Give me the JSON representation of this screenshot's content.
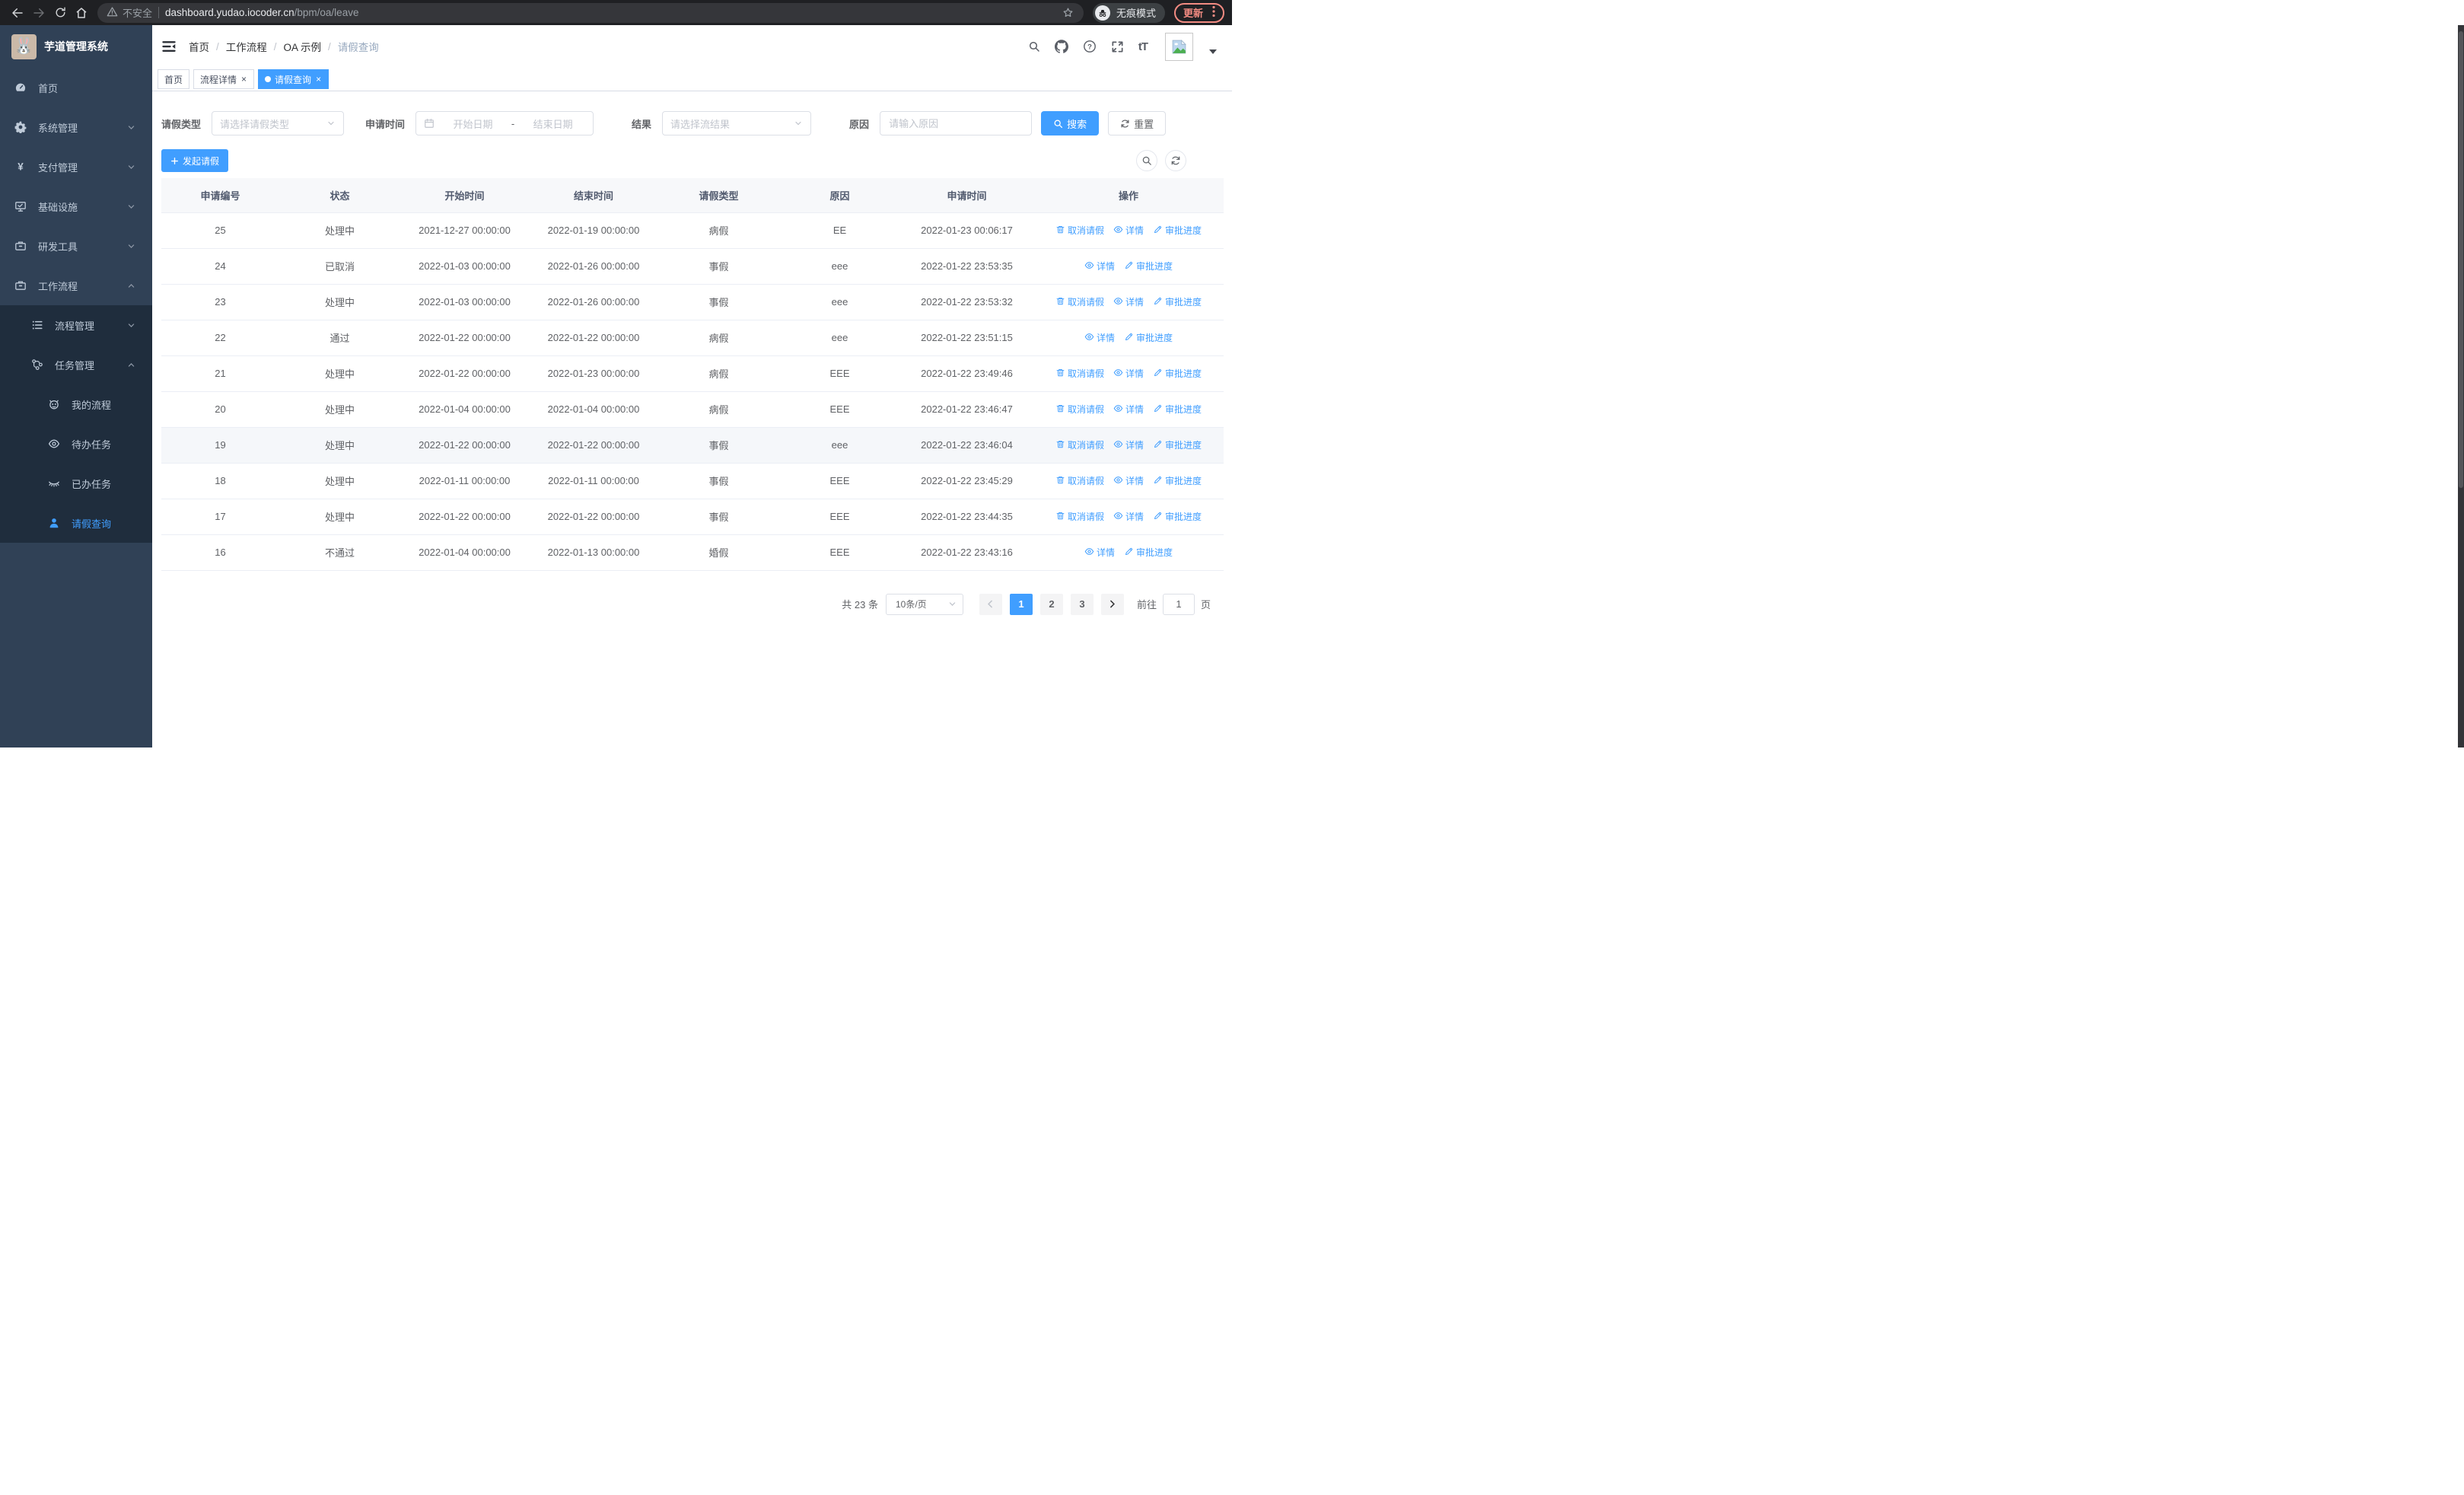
{
  "colors": {
    "primary": "#409EFF",
    "sidebar_bg": "#304156",
    "submenu_bg": "#1f2d3d"
  },
  "browser": {
    "security_label": "不安全",
    "url_host": "dashboard.yudao.iocoder.cn",
    "url_path": "/bpm/oa/leave",
    "incognito_label": "无痕模式",
    "update_label": "更新"
  },
  "sidebar": {
    "title": "芋道管理系统",
    "menu": [
      {
        "name": "home",
        "label": "首页",
        "icon": "gauge-icon",
        "level": 1
      },
      {
        "name": "system",
        "label": "系统管理",
        "icon": "gear-icon",
        "level": 1,
        "chevron": "down"
      },
      {
        "name": "payment",
        "label": "支付管理",
        "icon": "yen-icon",
        "level": 1,
        "chevron": "down"
      },
      {
        "name": "infra",
        "label": "基础设施",
        "icon": "monitor-icon",
        "level": 1,
        "chevron": "down"
      },
      {
        "name": "devtools",
        "label": "研发工具",
        "icon": "toolbox-icon",
        "level": 1,
        "chevron": "down"
      },
      {
        "name": "workflow",
        "label": "工作流程",
        "icon": "briefcase-icon",
        "level": 1,
        "chevron": "up"
      },
      {
        "name": "process-mgmt",
        "label": "流程管理",
        "icon": "list-icon",
        "level": 2,
        "sub": true,
        "chevron": "down"
      },
      {
        "name": "task-mgmt",
        "label": "任务管理",
        "icon": "branch-icon",
        "level": 2,
        "sub": true,
        "chevron": "up"
      },
      {
        "name": "my-process",
        "label": "我的流程",
        "icon": "robot-icon",
        "level": 3,
        "sub": true
      },
      {
        "name": "todo-task",
        "label": "待办任务",
        "icon": "eye-icon",
        "level": 3,
        "sub": true
      },
      {
        "name": "done-task",
        "label": "已办任务",
        "icon": "eye-closed-icon",
        "level": 3,
        "sub": true
      },
      {
        "name": "leave-query",
        "label": "请假查询",
        "icon": "user-icon",
        "level": 3,
        "sub": true,
        "active": true
      }
    ]
  },
  "header": {
    "breadcrumb": [
      "首页",
      "工作流程",
      "OA 示例",
      "请假查询"
    ],
    "icons": [
      "search-icon",
      "github-icon",
      "help-icon",
      "fullscreen-icon",
      "fontsize-icon"
    ],
    "fontsize_glyph": "tT"
  },
  "tabs": [
    {
      "label": "首页"
    },
    {
      "label": "流程详情",
      "closable": true
    },
    {
      "label": "请假查询",
      "closable": true,
      "active": true
    }
  ],
  "filters": {
    "leave_type_label": "请假类型",
    "leave_type_placeholder": "请选择请假类型",
    "apply_time_label": "申请时间",
    "date_start_placeholder": "开始日期",
    "date_separator": "-",
    "date_end_placeholder": "结束日期",
    "result_label": "结果",
    "result_placeholder": "请选择流结果",
    "reason_label": "原因",
    "reason_placeholder": "请输入原因",
    "search_button": "搜索",
    "reset_button": "重置"
  },
  "toolbar": {
    "create_button": "发起请假"
  },
  "table": {
    "columns": [
      "申请编号",
      "状态",
      "开始时间",
      "结束时间",
      "请假类型",
      "原因",
      "申请时间",
      "操作"
    ],
    "action_labels": {
      "cancel": "取消请假",
      "detail": "详情",
      "progress": "审批进度"
    },
    "rows": [
      {
        "id": "25",
        "status": "处理中",
        "start": "2021-12-27 00:00:00",
        "end": "2022-01-19 00:00:00",
        "type": "病假",
        "reason": "EE",
        "apply_time": "2022-01-23 00:06:17",
        "actions": [
          "cancel",
          "detail",
          "progress"
        ]
      },
      {
        "id": "24",
        "status": "已取消",
        "start": "2022-01-03 00:00:00",
        "end": "2022-01-26 00:00:00",
        "type": "事假",
        "reason": "eee",
        "apply_time": "2022-01-22 23:53:35",
        "actions": [
          "detail",
          "progress"
        ]
      },
      {
        "id": "23",
        "status": "处理中",
        "start": "2022-01-03 00:00:00",
        "end": "2022-01-26 00:00:00",
        "type": "事假",
        "reason": "eee",
        "apply_time": "2022-01-22 23:53:32",
        "actions": [
          "cancel",
          "detail",
          "progress"
        ]
      },
      {
        "id": "22",
        "status": "通过",
        "start": "2022-01-22 00:00:00",
        "end": "2022-01-22 00:00:00",
        "type": "病假",
        "reason": "eee",
        "apply_time": "2022-01-22 23:51:15",
        "actions": [
          "detail",
          "progress"
        ]
      },
      {
        "id": "21",
        "status": "处理中",
        "start": "2022-01-22 00:00:00",
        "end": "2022-01-23 00:00:00",
        "type": "病假",
        "reason": "EEE",
        "apply_time": "2022-01-22 23:49:46",
        "actions": [
          "cancel",
          "detail",
          "progress"
        ]
      },
      {
        "id": "20",
        "status": "处理中",
        "start": "2022-01-04 00:00:00",
        "end": "2022-01-04 00:00:00",
        "type": "病假",
        "reason": "EEE",
        "apply_time": "2022-01-22 23:46:47",
        "actions": [
          "cancel",
          "detail",
          "progress"
        ]
      },
      {
        "id": "19",
        "status": "处理中",
        "start": "2022-01-22 00:00:00",
        "end": "2022-01-22 00:00:00",
        "type": "事假",
        "reason": "eee",
        "apply_time": "2022-01-22 23:46:04",
        "actions": [
          "cancel",
          "detail",
          "progress"
        ],
        "hover": true
      },
      {
        "id": "18",
        "status": "处理中",
        "start": "2022-01-11 00:00:00",
        "end": "2022-01-11 00:00:00",
        "type": "事假",
        "reason": "EEE",
        "apply_time": "2022-01-22 23:45:29",
        "actions": [
          "cancel",
          "detail",
          "progress"
        ]
      },
      {
        "id": "17",
        "status": "处理中",
        "start": "2022-01-22 00:00:00",
        "end": "2022-01-22 00:00:00",
        "type": "事假",
        "reason": "EEE",
        "apply_time": "2022-01-22 23:44:35",
        "actions": [
          "cancel",
          "detail",
          "progress"
        ]
      },
      {
        "id": "16",
        "status": "不通过",
        "start": "2022-01-04 00:00:00",
        "end": "2022-01-13 00:00:00",
        "type": "婚假",
        "reason": "EEE",
        "apply_time": "2022-01-22 23:43:16",
        "actions": [
          "detail",
          "progress"
        ]
      }
    ]
  },
  "pagination": {
    "total": "共 23 条",
    "page_size": "10条/页",
    "pages": [
      "1",
      "2",
      "3"
    ],
    "active_page": "1",
    "goto_label": "前往",
    "goto_value": "1",
    "page_unit": "页"
  }
}
